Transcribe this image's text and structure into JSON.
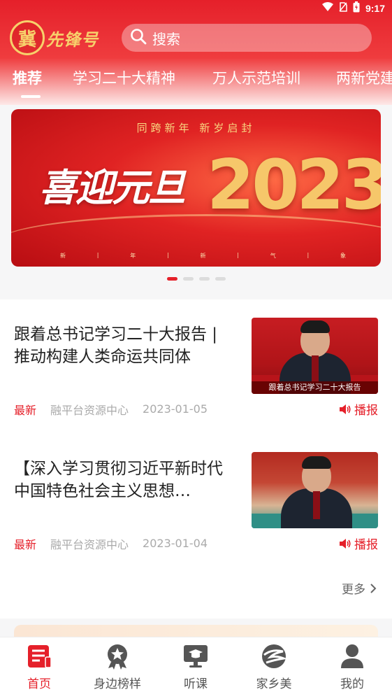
{
  "status_bar": {
    "time": "9:17"
  },
  "header": {
    "logo_seal": "冀",
    "logo_text": "先锋号",
    "search_placeholder": "搜索"
  },
  "tabs": [
    {
      "label": "推荐",
      "active": true
    },
    {
      "label": "学习二十大精神",
      "active": false
    },
    {
      "label": "万人示范培训",
      "active": false
    },
    {
      "label": "两新党建",
      "active": false
    }
  ],
  "banner": {
    "top_line": "同跨新年    新岁启封",
    "headline": "喜迎元旦",
    "year": "2023",
    "bottom_chars": [
      "新",
      "|",
      "年",
      "|",
      "新",
      "|",
      "气",
      "|",
      "象"
    ],
    "carousel_count": 4,
    "carousel_active": 0
  },
  "news": [
    {
      "title": "跟着总书记学习二十大报告 | 推动构建人类命运共同体",
      "tag": "最新",
      "source": "融平台资源中心",
      "date": "2023-01-05",
      "broadcast": "播报",
      "thumb_caption": "跟着总书记学习二十大报告"
    },
    {
      "title": "【深入学习贯彻习近平新时代中国特色社会主义思想…",
      "tag": "最新",
      "source": "融平台资源中心",
      "date": "2023-01-04",
      "broadcast": "播报",
      "thumb_caption": ""
    }
  ],
  "more_label": "更多",
  "bottom_nav": [
    {
      "label": "首页",
      "icon": "home-doc-icon",
      "active": true
    },
    {
      "label": "身边榜样",
      "icon": "star-badge-icon",
      "active": false
    },
    {
      "label": "听课",
      "icon": "lecture-screen-icon",
      "active": false
    },
    {
      "label": "家乡美",
      "icon": "hometown-globe-icon",
      "active": false
    },
    {
      "label": "我的",
      "icon": "user-icon",
      "active": false
    }
  ],
  "colors": {
    "accent": "#e5202a",
    "muted": "#aaaaaa"
  }
}
